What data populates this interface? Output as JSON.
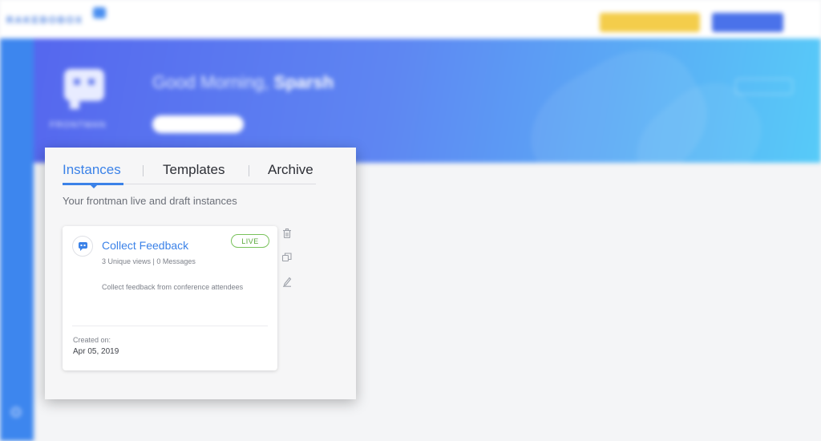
{
  "colors": {
    "accent": "#3b82e8",
    "live": "#5aa83a",
    "hero_start": "#5567ee",
    "hero_end": "#57cbf8",
    "sidebar": "#3d86ee"
  },
  "tabs": [
    {
      "label": "Instances",
      "active": true
    },
    {
      "label": "Templates",
      "active": false
    },
    {
      "label": "Archive",
      "active": false
    }
  ],
  "panel": {
    "subtitle": "Your frontman live and draft instances"
  },
  "instance": {
    "icon": "chat-bot-icon",
    "title": "Collect Feedback",
    "status": "LIVE",
    "stats": "3 Unique views | 0 Messages",
    "description": "Collect feedback from conference attendees",
    "created_label": "Created on:",
    "created_date": "Apr 05, 2019"
  },
  "actions": [
    {
      "name": "delete",
      "icon": "trash-icon"
    },
    {
      "name": "duplicate",
      "icon": "copy-icon"
    },
    {
      "name": "edit",
      "icon": "pencil-icon"
    }
  ]
}
